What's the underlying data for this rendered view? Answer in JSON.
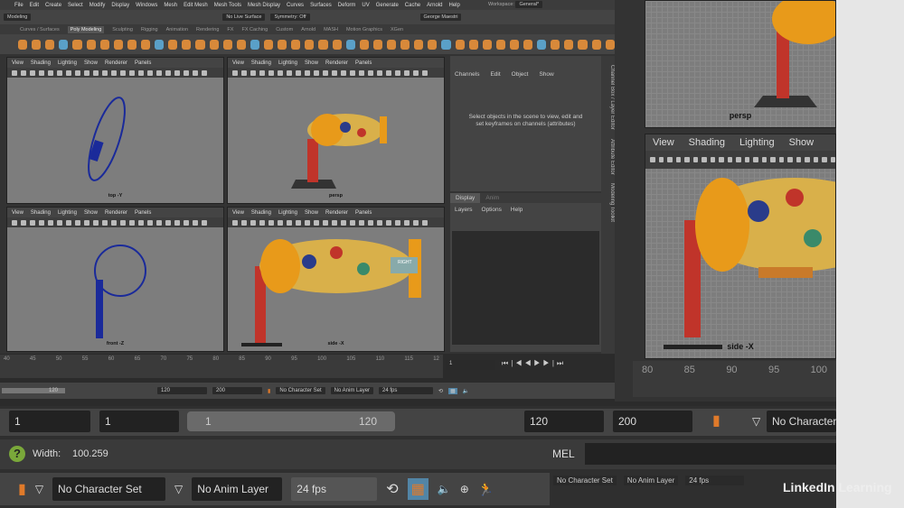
{
  "menu": [
    "File",
    "Edit",
    "Create",
    "Select",
    "Modify",
    "Display",
    "Windows",
    "Mesh",
    "Edit Mesh",
    "Mesh Tools",
    "Mesh Display",
    "Curves",
    "Surfaces",
    "Deform",
    "UV",
    "Generate",
    "Cache",
    "Arnold",
    "Help"
  ],
  "workspace_label": "Workspace:",
  "workspace_value": "General*",
  "status": {
    "mode": "Modeling",
    "live_surface": "No Live Surface",
    "symmetry": "Symmetry: Off",
    "user": "George Maestri"
  },
  "shelf_tabs": [
    "Curves / Surfaces",
    "Poly Modeling",
    "Sculpting",
    "Rigging",
    "Animation",
    "Rendering",
    "FX",
    "FX Caching",
    "Custom",
    "Arnold",
    "MASH",
    "Motion Graphics",
    "XGen"
  ],
  "shelf_active": "Poly Modeling",
  "viewport_menu": [
    "View",
    "Shading",
    "Lighting",
    "Show",
    "Renderer",
    "Panels"
  ],
  "viewports": {
    "top": "top -Y",
    "persp": "persp",
    "front": "front -Z",
    "side": "side -X",
    "side_cube": "RIGHT"
  },
  "channel_box": {
    "menu": [
      "Channels",
      "Edit",
      "Object",
      "Show"
    ],
    "message": "Select objects in the scene to view, edit and set keyframes on channels (attributes)",
    "side_tabs": [
      "Channel Box / Layer Editor",
      "Attribute Editor",
      "Modeling Toolkit"
    ]
  },
  "layer_editor": {
    "tabs": [
      "Display",
      "Anim"
    ],
    "menu": [
      "Layers",
      "Options",
      "Help"
    ]
  },
  "timeline": {
    "ticks": [
      "40",
      "45",
      "50",
      "55",
      "60",
      "65",
      "70",
      "75",
      "80",
      "85",
      "90",
      "95",
      "100",
      "105",
      "110",
      "115",
      "12"
    ],
    "current_frame": "1"
  },
  "range": {
    "start": "1",
    "inner_start": "1",
    "inner_end": "120",
    "end": "120",
    "anim_end": "200",
    "character_set": "No Character Set",
    "anim_layer": "No Anim Layer",
    "fps": "24 fps"
  },
  "zoom_timeline_ticks": [
    "80",
    "85",
    "90",
    "95",
    "100"
  ],
  "zoom_menu": [
    "View",
    "Shading",
    "Lighting",
    "Show"
  ],
  "help_line": {
    "label": "Width:",
    "value": "100.259"
  },
  "mel_label": "MEL",
  "watermark": "LinkedIn Learning",
  "colors": {
    "accent_orange": "#e07a2a",
    "selected_blue": "#5285a6",
    "viewport_gray": "#7d7d7d"
  }
}
